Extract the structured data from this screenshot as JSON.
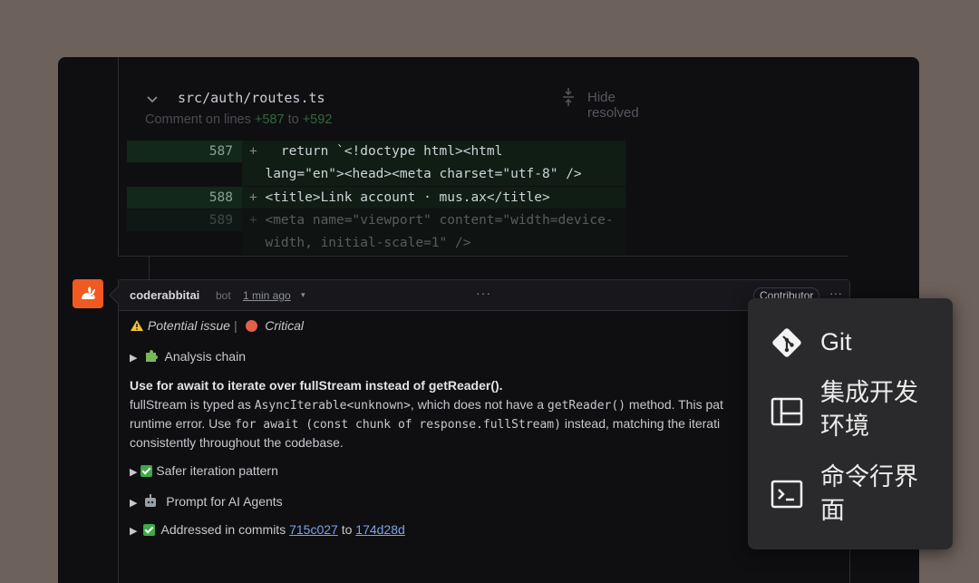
{
  "file": {
    "path": "src/auth/routes.ts",
    "hide_resolved": "Hide resolved",
    "comment_on": "Comment on lines",
    "start": "+587",
    "to": "to",
    "end": "+592"
  },
  "diff": [
    {
      "num": "587",
      "plus": "+",
      "lines": [
        "  return `<!doctype html><html",
        "lang=\"en\"><head><meta charset=\"utf-8\" />"
      ]
    },
    {
      "num": "588",
      "plus": "+",
      "lines": [
        "<title>Link account · mus.ax</title>"
      ]
    },
    {
      "num": "589",
      "plus": "+",
      "lines": [
        "<meta name=\"viewport\" content=\"width=device-",
        "width, initial-scale=1\" />"
      ]
    }
  ],
  "comment": {
    "author": "coderabbitai",
    "role": "bot",
    "time": "1 min ago",
    "badge": "Contributor",
    "more": "···",
    "potential_issue": "Potential issue",
    "separator": "|",
    "critical": "Critical",
    "analysis_chain": "Analysis chain",
    "heading": "Use for await to iterate over fullStream instead of getReader().",
    "para": {
      "t1": "fullStream is typed as ",
      "c1": "AsyncIterable<unknown>",
      "t2": ", which does not have a ",
      "c2": "getReader()",
      "t3": " method. This pat",
      "t4": "runtime error. Use ",
      "c3": "for await (const chunk of response.fullStream)",
      "t5": " instead, matching the iterati",
      "t6": "consistently throughout the codebase."
    },
    "safer": "Safer iteration pattern",
    "prompt": "Prompt for AI Agents",
    "addressed": "Addressed in commits",
    "commit_a": "715c027",
    "to": "to",
    "commit_b": "174d28d"
  },
  "menu": {
    "items": [
      {
        "label_lines": [
          "Git"
        ],
        "icon": "git-icon"
      },
      {
        "label_lines": [
          "集成开发",
          "环境"
        ],
        "icon": "ide-icon"
      },
      {
        "label_lines": [
          "命令行界",
          "面"
        ],
        "icon": "terminal-icon"
      }
    ]
  },
  "colors": {
    "accent_orange": "#f05a22",
    "addition_green": "#3ea84a",
    "critical_red": "#e5604a",
    "link_blue": "#7aa3e6"
  }
}
